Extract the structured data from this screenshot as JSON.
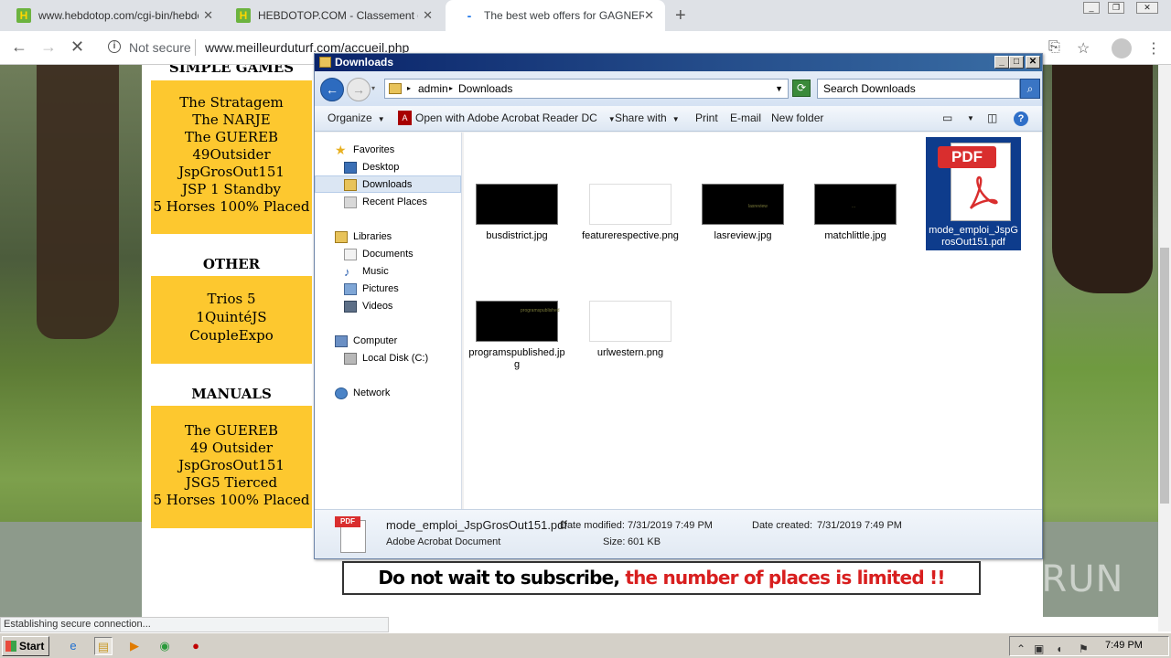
{
  "browser": {
    "tabs": [
      {
        "title": "www.hebdotop.com/cgi-bin/hebdoto",
        "favicon_label": "H"
      },
      {
        "title": "HEBDOTOP.COM - Classement de sit",
        "favicon_label": "H"
      },
      {
        "title": "The best web offers for GAGNER AU",
        "favicon_label": "-"
      }
    ],
    "new_tab": "+",
    "security_label": "Not secure",
    "url": "www.meilleurduturf.com/accueil.php",
    "status_text": "Establishing secure connection..."
  },
  "page": {
    "section1_title": "SIMPLE GAMES",
    "section1_items": [
      "The Stratagem",
      "The NARJE",
      "The GUEREB",
      "49Outsider",
      "JspGrosOut151",
      "JSP 1 Standby",
      "5 Horses 100% Placed"
    ],
    "section2_title": "OTHER",
    "section2_items": [
      "Trios 5",
      "1QuintéJS",
      "CoupleExpo"
    ],
    "section3_title": "MANUALS",
    "section3_items": [
      "The GUEREB",
      "49 Outsider",
      "JspGrosOut151",
      "JSG5 Tierced",
      "5 Horses 100% Placed"
    ],
    "banner_black": "Do not wait to subscribe,",
    "banner_red": "the number of places is limited !!",
    "watermark": "ANY RUN"
  },
  "explorer": {
    "title": "Downloads",
    "breadcrumb": [
      "admin",
      "Downloads"
    ],
    "search_placeholder": "Search Downloads",
    "commands": {
      "organize": "Organize",
      "open_with": "Open with Adobe Acrobat Reader DC",
      "share_with": "Share with",
      "print": "Print",
      "email": "E-mail",
      "new_folder": "New folder"
    },
    "nav": {
      "favorites": "Favorites",
      "desktop": "Desktop",
      "downloads": "Downloads",
      "recent": "Recent Places",
      "libraries": "Libraries",
      "documents": "Documents",
      "music": "Music",
      "pictures": "Pictures",
      "videos": "Videos",
      "computer": "Computer",
      "local_disk": "Local Disk (C:)",
      "network": "Network"
    },
    "files": [
      {
        "name": "busdistrict.jpg",
        "thumb_text": ""
      },
      {
        "name": "featurerespective.png",
        "thumb_text": ""
      },
      {
        "name": "lasreview.jpg",
        "thumb_text": "lasreview"
      },
      {
        "name": "matchlittle.jpg",
        "thumb_text": "..."
      },
      {
        "name": "mode_emploi_JspGrosOut151.pdf",
        "thumb_text": "PDF"
      },
      {
        "name": "programspublished.jpg",
        "thumb_text": "programspublished"
      },
      {
        "name": "urlwestern.png",
        "thumb_text": ""
      }
    ],
    "details": {
      "name": "mode_emploi_JspGrosOut151.pdf",
      "type": "Adobe Acrobat Document",
      "modified_label": "Date modified:",
      "modified_value": "7/31/2019 7:49 PM",
      "created_label": "Date created:",
      "created_value": "7/31/2019 7:49 PM",
      "size_label": "Size:",
      "size_value": "601 KB",
      "icon_badge": "PDF"
    }
  },
  "taskbar": {
    "start": "Start",
    "clock": "7:49 PM"
  }
}
